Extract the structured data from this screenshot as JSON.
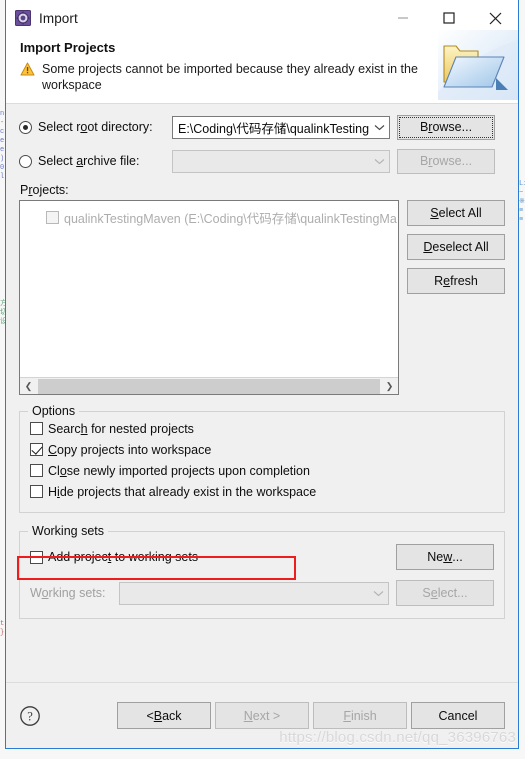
{
  "window": {
    "title": "Import",
    "icon": "import-wizard-icon",
    "controls": {
      "minimize": "minimize-icon",
      "maximize": "maximize-icon",
      "close": "close-icon"
    }
  },
  "header": {
    "title": "Import Projects",
    "message": "Some projects cannot be imported because they already exist in the workspace",
    "warning_icon": "warning-triangle-icon",
    "banner_icon": "folder-import-icon"
  },
  "source": {
    "root_directory": {
      "label_pre": "Select r",
      "label_accel": "o",
      "label_post": "ot directory:",
      "selected": true,
      "value": "E:\\Coding\\代码存储\\qualinkTestingMav",
      "browse_label_pre": "B",
      "browse_label_accel": "r",
      "browse_label_post": "owse...",
      "browse_enabled": true
    },
    "archive_file": {
      "label_pre": "Select ",
      "label_accel": "a",
      "label_post": "rchive file:",
      "selected": false,
      "value": "",
      "browse_label_pre": "B",
      "browse_label_accel": "r",
      "browse_label_post": "owse...",
      "browse_enabled": false
    }
  },
  "projects": {
    "label_pre": "P",
    "label_accel": "r",
    "label_post": "ojects:",
    "items": [
      {
        "label": "qualinkTestingMaven (E:\\Coding\\代码存储\\qualinkTestingMa",
        "checked": false,
        "enabled": false
      }
    ],
    "buttons": [
      {
        "name": "select-all",
        "pre": "",
        "accel": "S",
        "post": "elect All"
      },
      {
        "name": "deselect-all",
        "pre": "",
        "accel": "D",
        "post": "eselect All"
      },
      {
        "name": "refresh",
        "pre": "R",
        "accel": "e",
        "post": "fresh"
      }
    ],
    "scrollbar": {
      "left_arrow": "chevron-left-icon",
      "right_arrow": "chevron-right-icon"
    }
  },
  "options": {
    "caption": "Options",
    "items": [
      {
        "name": "search-nested",
        "pre": "Search for nested projects",
        "accel": "",
        "post": "",
        "label": "Search for nested projects",
        "checked": false,
        "highlighted": false
      },
      {
        "name": "copy-into-workspace",
        "label": "Copy projects into workspace",
        "checked": true,
        "highlighted": true
      },
      {
        "name": "close-newly-imported",
        "label": "Close newly imported projects upon completion",
        "checked": false,
        "highlighted": false
      },
      {
        "name": "hide-existing",
        "label": "Hide projects that already exist in the workspace",
        "checked": false,
        "highlighted": false
      }
    ],
    "highlight_color": "#ee1c1c"
  },
  "working_sets": {
    "caption": "Working sets",
    "add_checkbox": {
      "pre": "Add projec",
      "accel": "t",
      "post": " to working sets",
      "checked": false
    },
    "new_button": {
      "pre": "Ne",
      "accel": "w",
      "post": "..."
    },
    "list_label": {
      "pre": "W",
      "accel": "o",
      "post": "rking sets:"
    },
    "list_value": "",
    "select_button": {
      "pre": "S",
      "accel": "e",
      "post": "lect..."
    },
    "enabled": false
  },
  "footer": {
    "help_icon": "help-question-icon",
    "buttons": [
      {
        "name": "back",
        "pre": "< ",
        "accel": "B",
        "post": "ack",
        "enabled": true
      },
      {
        "name": "next",
        "pre": "",
        "accel": "N",
        "post": "ext >",
        "enabled": false
      },
      {
        "name": "finish",
        "pre": "",
        "accel": "F",
        "post": "inish",
        "enabled": false
      },
      {
        "name": "cancel",
        "pre": "",
        "accel": "",
        "post": "Cancel",
        "enabled": true
      }
    ]
  },
  "watermark": "https://blog.csdn.net/qq_36396763",
  "backdrop": {
    "left_fragments": [
      "n",
      "-",
      "c",
      "e",
      "e",
      ")",
      "0",
      "l",
      "方",
      "切",
      "设",
      "t",
      "}"
    ],
    "right_fragments": [
      "Li",
      "~",
      "※",
      "≡",
      "≡"
    ]
  }
}
